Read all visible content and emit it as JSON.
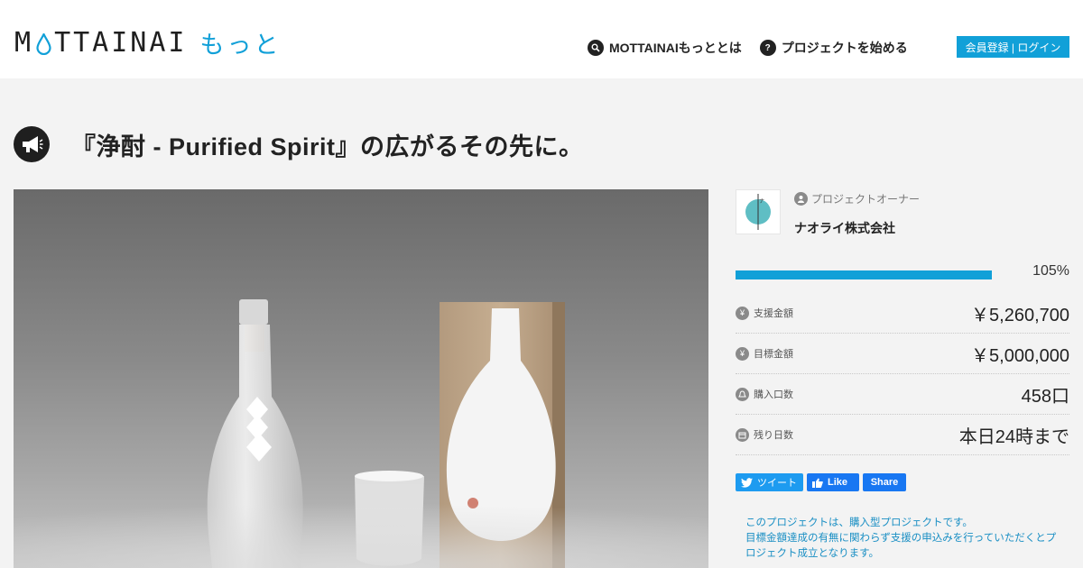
{
  "header": {
    "logo_text_part1": "M",
    "logo_text_part2": "TTAINAI",
    "logo_sub": "もっと",
    "nav": [
      {
        "label": "MOTTAINAIもっととは",
        "icon": "search-icon"
      },
      {
        "label": "プロジェクトを始める",
        "icon": "question-icon"
      }
    ],
    "login_label": "会員登録 | ログイン"
  },
  "project": {
    "title": "『浄酎 - Purified Spirit』の広がるその先に。",
    "owner_label": "プロジェクトオーナー",
    "owner_name": "ナオライ株式会社",
    "progress_pct": "105%",
    "progress_fraction": 1.0,
    "stats": [
      {
        "icon": "yen-icon",
        "label": "支援金額",
        "value": "￥5,260,700"
      },
      {
        "icon": "yen-icon",
        "label": "目標金額",
        "value": "￥5,000,000"
      },
      {
        "icon": "bell-icon",
        "label": "購入口数",
        "value": "458口"
      },
      {
        "icon": "calendar-icon",
        "label": "残り日数",
        "value": "本日24時まで"
      }
    ],
    "share": {
      "tweet_label": "ツイート",
      "like_label": "Like",
      "share_label": "Share"
    },
    "note_line1": "このプロジェクトは、購入型プロジェクトです。",
    "note_line2": "目標金額達成の有無に関わらず支援の申込みを行っていただくとプロジェクト成立となります。"
  },
  "colors": {
    "accent": "#11a0d8",
    "dark": "#1f1f1f",
    "background": "#f3f3f3"
  }
}
